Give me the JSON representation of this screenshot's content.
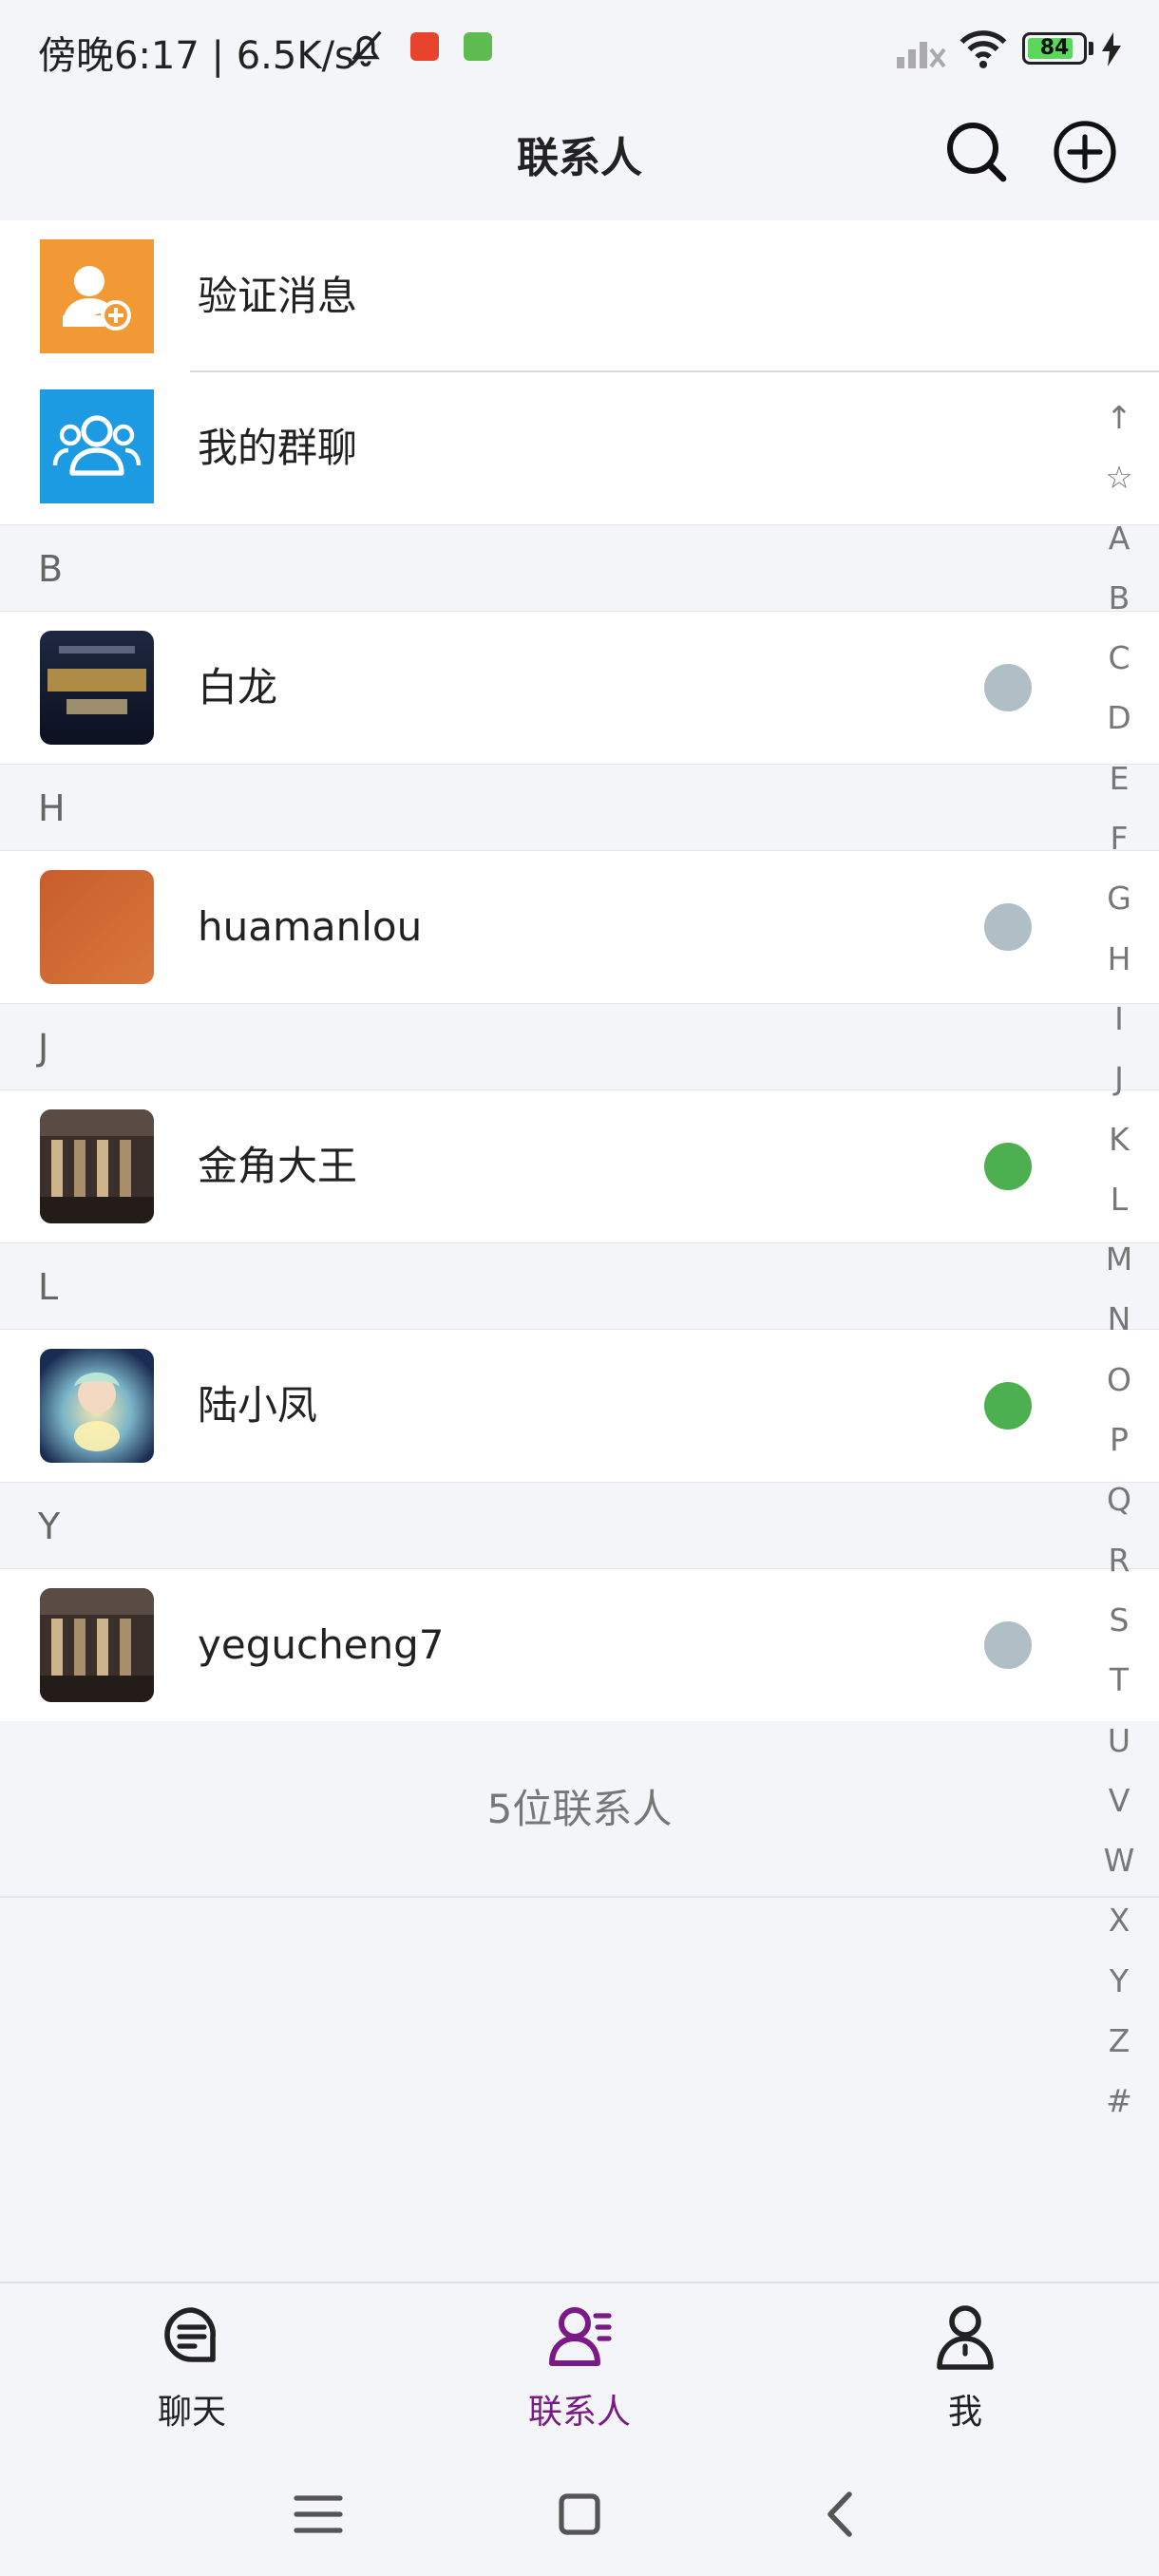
{
  "status_bar": {
    "time_speed": "傍晚6:17 | 6.5K/s",
    "battery_level": "84",
    "battery_fraction": 0.84,
    "battery_color": "#5cd65c"
  },
  "header": {
    "title": "联系人"
  },
  "quick_items": [
    {
      "label": "验证消息",
      "icon": "add-user-icon",
      "color": "#f19a35"
    },
    {
      "label": "我的群聊",
      "icon": "group-icon",
      "color": "#1c9be3"
    }
  ],
  "sections": [
    {
      "letter": "B",
      "contacts": [
        {
          "name": "白龙",
          "online": false,
          "avatar": "warcraft-avatar"
        }
      ]
    },
    {
      "letter": "H",
      "contacts": [
        {
          "name": "huamanlou",
          "online": false,
          "avatar": "orange-avatar"
        }
      ]
    },
    {
      "letter": "J",
      "contacts": [
        {
          "name": "金角大王",
          "online": true,
          "avatar": "building-avatar"
        }
      ]
    },
    {
      "letter": "L",
      "contacts": [
        {
          "name": "陆小凤",
          "online": true,
          "avatar": "fairy-avatar"
        }
      ]
    },
    {
      "letter": "Y",
      "contacts": [
        {
          "name": "yegucheng7",
          "online": false,
          "avatar": "building-avatar"
        }
      ]
    }
  ],
  "count_text": "5位联系人",
  "status_colors": {
    "online": "#4caf50",
    "offline": "#b0bec5"
  },
  "alphabet_index": [
    "↑",
    "☆",
    "A",
    "B",
    "C",
    "D",
    "E",
    "F",
    "G",
    "H",
    "I",
    "J",
    "K",
    "L",
    "M",
    "N",
    "O",
    "P",
    "Q",
    "R",
    "S",
    "T",
    "U",
    "V",
    "W",
    "X",
    "Y",
    "Z",
    "#"
  ],
  "bottom_nav": [
    {
      "label": "聊天",
      "icon": "chat-icon",
      "active": false
    },
    {
      "label": "联系人",
      "icon": "contacts-icon",
      "active": true
    },
    {
      "label": "我",
      "icon": "person-icon",
      "active": false
    }
  ],
  "accent_color": "#7b1a86"
}
